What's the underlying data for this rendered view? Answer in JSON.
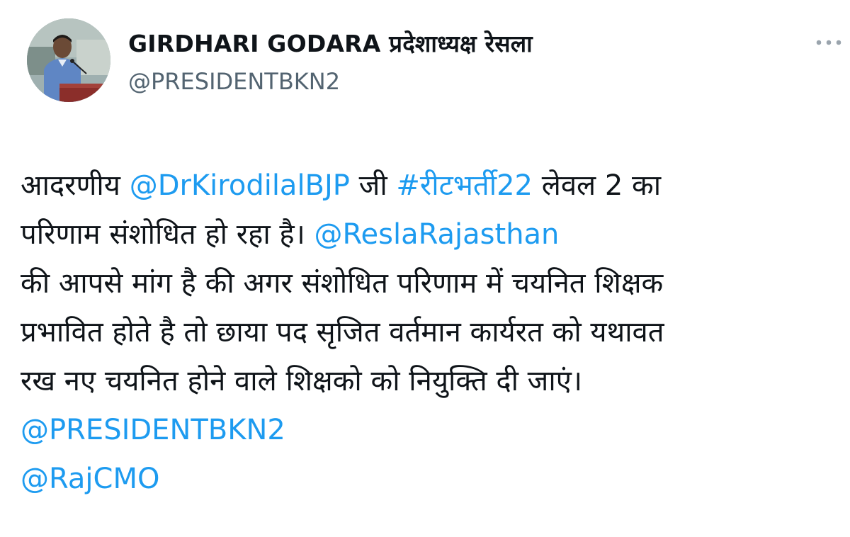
{
  "author": {
    "display_name": "GIRDHARI GODARA प्रदेशाध्यक्ष रेसला",
    "handle": "@PRESIDENTBKN2",
    "avatar_icon": "profile-photo-speaker-at-podium"
  },
  "more_icon": "more-horizontal-icon",
  "colors": {
    "link": "#1d9bf0",
    "text": "#0f1419",
    "secondary": "#536471"
  },
  "tweet": {
    "line1": {
      "t1": "आदरणीय ",
      "mention1": "@DrKirodilalBJP",
      "t2": " जी ",
      "hashtag": "#रीटभर्ती22",
      "t3": " लेवल 2 का"
    },
    "line2": {
      "t1": "परिणाम संशोधित हो रहा है। ",
      "mention2": "@ReslaRajasthan"
    },
    "line3": "की आपसे मांग है की अगर संशोधित परिणाम में चयनित शिक्षक",
    "line4": "प्रभावित होते है तो छाया पद सृजित वर्तमान कार्यरत को यथावत",
    "line5": "रख नए चयनित होने वाले शिक्षको को नियुक्ति दी जाएं।",
    "mention3": "@PRESIDENTBKN2",
    "mention4": "@RajCMO"
  }
}
